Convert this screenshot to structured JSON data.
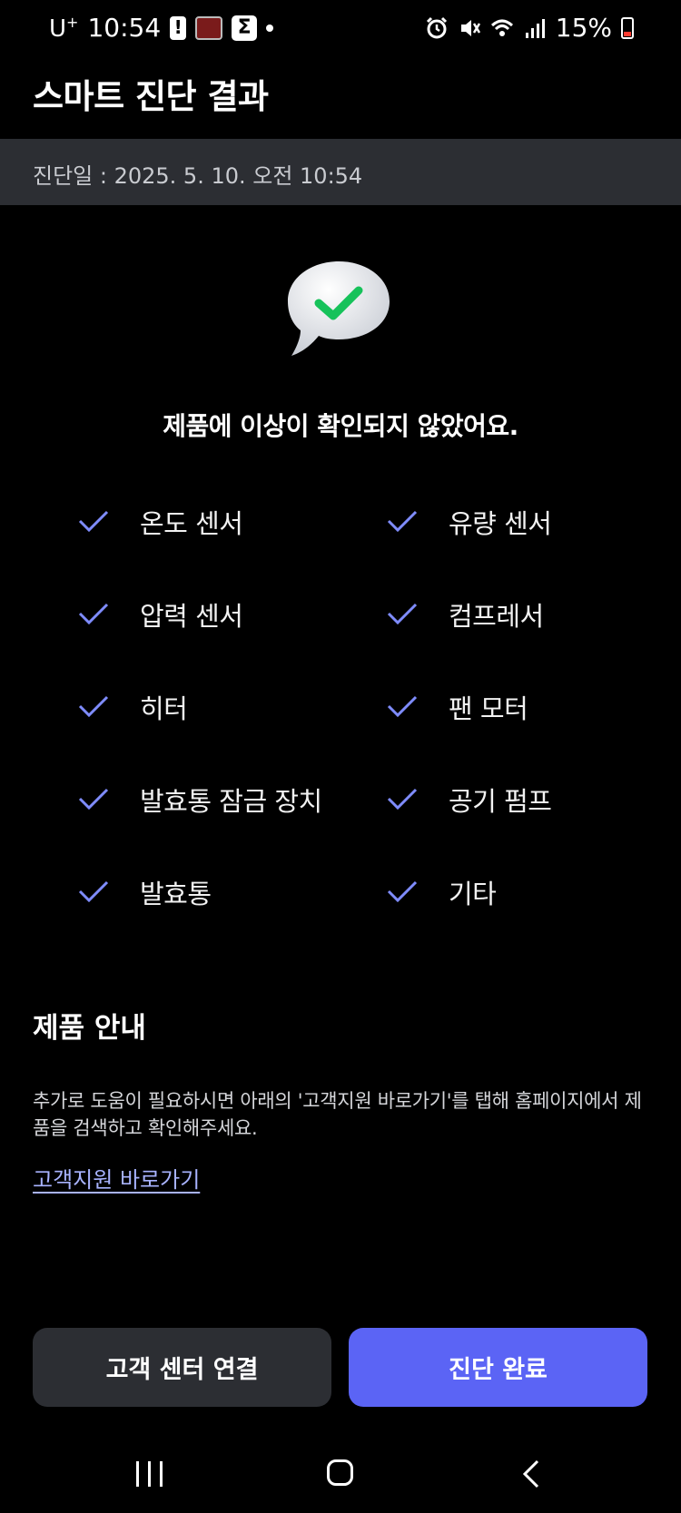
{
  "status_bar": {
    "carrier": "U",
    "carrier_plus": "+",
    "time": "10:54",
    "battery": "15%"
  },
  "header": {
    "title": "스마트 진단 결과"
  },
  "date_bar": {
    "text": "진단일 : 2025. 5. 10. 오전 10:54"
  },
  "result": {
    "message": "제품에 이상이 확인되지 않았어요."
  },
  "checks": [
    "온도 센서",
    "유량 센서",
    "압력 센서",
    "컴프레서",
    "히터",
    "팬 모터",
    "발효통 잠금 장치",
    "공기 펌프",
    "발효통",
    "기타"
  ],
  "guide": {
    "title": "제품 안내",
    "description": "추가로 도움이 필요하시면 아래의 '고객지원 바로가기'를 탭해 홈페이지에서 제품을 검색하고 확인해주세요.",
    "link": "고객지원 바로가기"
  },
  "buttons": {
    "secondary": "고객 센터 연결",
    "primary": "진단 완료"
  },
  "colors": {
    "background": "#000000",
    "panel": "#2c2e33",
    "accent": "#5b64f5",
    "check": "#7f8cff",
    "link": "#a8b3ff",
    "success": "#16c25a"
  }
}
